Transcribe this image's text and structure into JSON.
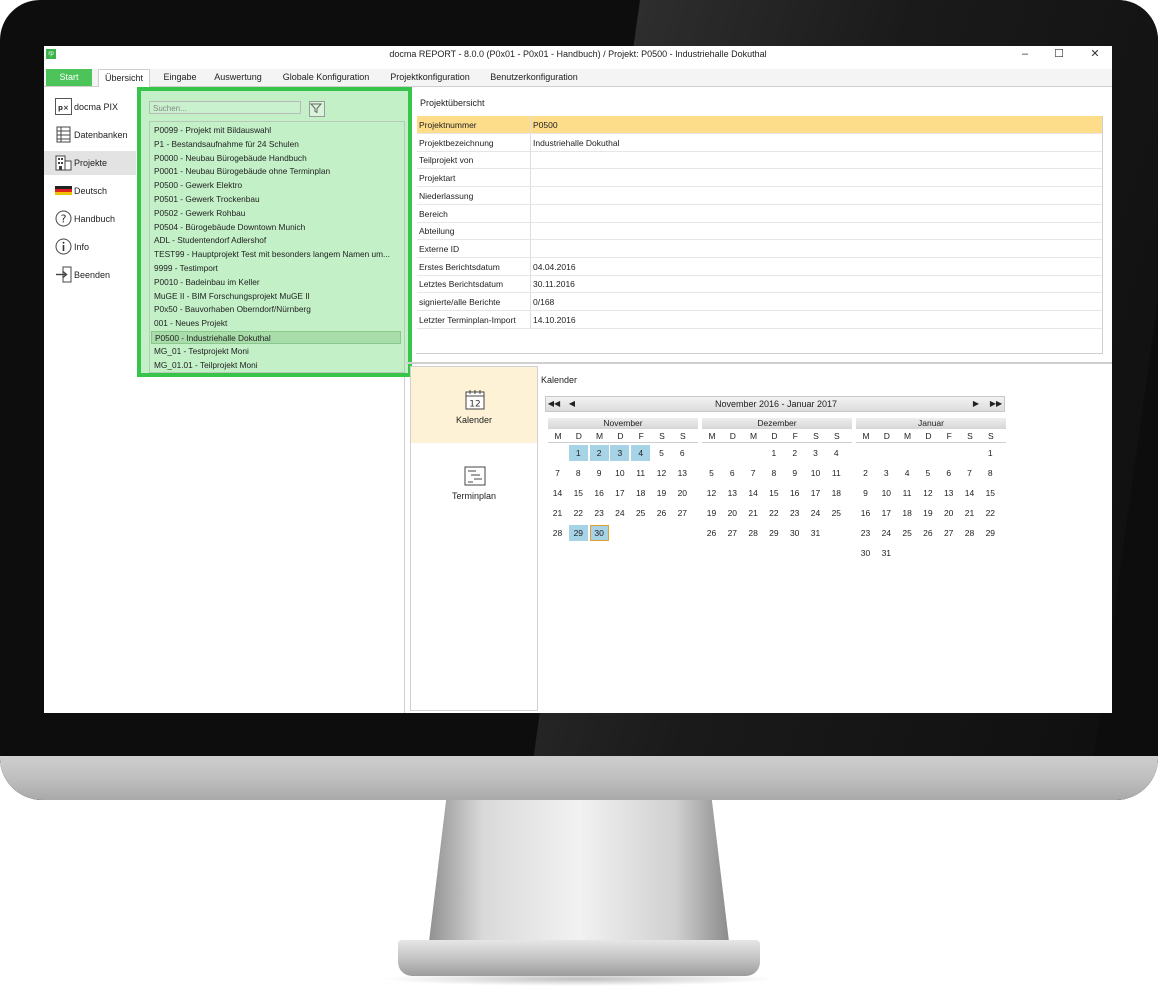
{
  "window": {
    "title": "docma REPORT - 8.0.0 (P0x01 - P0x01 - Handbuch) / Projekt: P0500  - Industriehalle Dokuthal",
    "app_icon": "rp",
    "minimize": "–",
    "maximize": "☐",
    "close": "✕"
  },
  "ribbon": {
    "tabs": [
      {
        "label": "Start"
      },
      {
        "label": "Übersicht"
      },
      {
        "label": "Eingabe"
      },
      {
        "label": "Auswertung"
      },
      {
        "label": "Globale Konfiguration"
      },
      {
        "label": "Projektkonfiguration"
      },
      {
        "label": "Benutzerkonfiguration"
      }
    ],
    "active": "Übersicht"
  },
  "nav": {
    "items": [
      {
        "label": "docma PIX",
        "icon": "pix-icon"
      },
      {
        "label": "Datenbanken",
        "icon": "database-icon"
      },
      {
        "label": "Projekte",
        "icon": "building-icon"
      },
      {
        "label": "Deutsch",
        "icon": "flag-icon"
      },
      {
        "label": "Handbuch",
        "icon": "help-icon"
      },
      {
        "label": "Info",
        "icon": "info-icon"
      },
      {
        "label": "Beenden",
        "icon": "exit-icon"
      }
    ],
    "active": "Projekte",
    "pix_logo": "p×"
  },
  "projects": {
    "search_placeholder": "Suchen...",
    "items": [
      "P0099 - Projekt mit Bildauswahl",
      "P1 - Bestandsaufnahme für 24 Schulen",
      "P0000 - Neubau Bürogebäude Handbuch",
      "P0001 - Neubau Bürogebäude ohne Terminplan",
      "P0500 - Gewerk Elektro",
      "P0501 - Gewerk Trockenbau",
      "P0502 - Gewerk Rohbau",
      "P0504 - Bürogebäude Downtown Munich",
      "ADL - Studentendorf Adlershof",
      "TEST99 - Hauptprojekt Test mit besonders langem Namen um...",
      "9999 - Testimport",
      "P0010 - Badeinbau im Keller",
      "MuGE II - BIM Forschungsprojekt MuGE II",
      "P0x50 - Bauvorhaben Oberndorf/Nürnberg",
      "001 - Neues Projekt",
      "P0500  - Industriehalle Dokuthal",
      "MG_01 - Testprojekt Moni",
      "MG_01.01 - Teilprojekt Moni"
    ],
    "selected_index": 15
  },
  "overview": {
    "title": "Projektübersicht",
    "rows": [
      {
        "label": "Projektnummer",
        "value": "P0500"
      },
      {
        "label": "Projektbezeichnung",
        "value": "Industriehalle Dokuthal"
      },
      {
        "label": "Teilprojekt von",
        "value": ""
      },
      {
        "label": "Projektart",
        "value": ""
      },
      {
        "label": "Niederlassung",
        "value": ""
      },
      {
        "label": "Bereich",
        "value": ""
      },
      {
        "label": "Abteilung",
        "value": ""
      },
      {
        "label": "Externe ID",
        "value": ""
      },
      {
        "label": "Erstes Berichtsdatum",
        "value": "04.04.2016"
      },
      {
        "label": "Letztes Berichtsdatum",
        "value": "30.11.2016"
      },
      {
        "label": "signierte/alle Berichte",
        "value": "0/168"
      },
      {
        "label": "Letzter Terminplan-Import",
        "value": "14.10.2016"
      }
    ]
  },
  "side_tabs": [
    {
      "label": "Kalender",
      "icon": "calendar-icon",
      "icon_text": "12"
    },
    {
      "label": "Terminplan",
      "icon": "schedule-icon"
    }
  ],
  "calendar": {
    "title": "Kalender",
    "range": "November 2016 - Januar 2017",
    "nav": {
      "first": "◀◀",
      "prev": "◀",
      "next": "▶",
      "last": "▶▶"
    },
    "day_names": [
      "M",
      "D",
      "M",
      "D",
      "F",
      "S",
      "S"
    ],
    "months": [
      {
        "name": "November",
        "weeks": [
          [
            "",
            "1",
            "2",
            "3",
            "4",
            "5",
            "6"
          ],
          [
            "7",
            "8",
            "9",
            "10",
            "11",
            "12",
            "13"
          ],
          [
            "14",
            "15",
            "16",
            "17",
            "18",
            "19",
            "20"
          ],
          [
            "21",
            "22",
            "23",
            "24",
            "25",
            "26",
            "27"
          ],
          [
            "28",
            "29",
            "30",
            "",
            "",
            "",
            ""
          ]
        ],
        "highlighted": [
          "1",
          "2",
          "3",
          "4",
          "29",
          "30"
        ],
        "today": "30"
      },
      {
        "name": "Dezember",
        "weeks": [
          [
            "",
            "",
            "",
            "1",
            "2",
            "3",
            "4"
          ],
          [
            "5",
            "6",
            "7",
            "8",
            "9",
            "10",
            "11"
          ],
          [
            "12",
            "13",
            "14",
            "15",
            "16",
            "17",
            "18"
          ],
          [
            "19",
            "20",
            "21",
            "22",
            "23",
            "24",
            "25"
          ],
          [
            "26",
            "27",
            "28",
            "29",
            "30",
            "31",
            ""
          ]
        ],
        "highlighted": [],
        "today": ""
      },
      {
        "name": "Januar",
        "weeks": [
          [
            "",
            "",
            "",
            "",
            "",
            "",
            "1"
          ],
          [
            "2",
            "3",
            "4",
            "5",
            "6",
            "7",
            "8"
          ],
          [
            "9",
            "10",
            "11",
            "12",
            "13",
            "14",
            "15"
          ],
          [
            "16",
            "17",
            "18",
            "19",
            "20",
            "21",
            "22"
          ],
          [
            "23",
            "24",
            "25",
            "26",
            "27",
            "28",
            "29"
          ],
          [
            "30",
            "31",
            "",
            "",
            "",
            "",
            ""
          ]
        ],
        "highlighted": [],
        "today": ""
      }
    ]
  },
  "colors": {
    "accent_green": "#37c44a",
    "selected_row": "#fddc8a",
    "calendar_highlight": "#a6d3e6"
  }
}
